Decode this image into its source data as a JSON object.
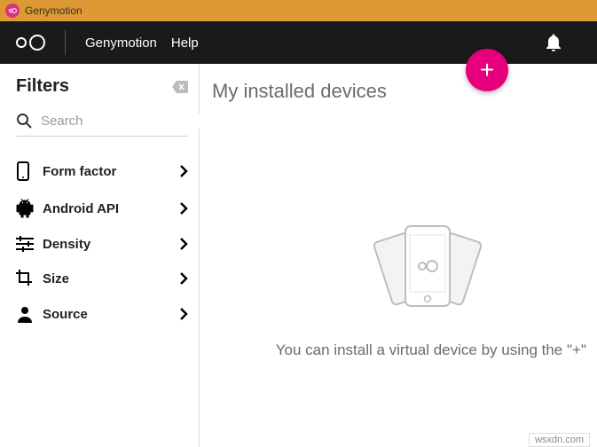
{
  "window": {
    "title": "Genymotion"
  },
  "menubar": {
    "items": [
      "Genymotion",
      "Help"
    ]
  },
  "sidebar": {
    "title": "Filters",
    "search_placeholder": "Search",
    "filters": [
      {
        "label": "Form factor",
        "icon": "phone-icon"
      },
      {
        "label": "Android API",
        "icon": "android-icon"
      },
      {
        "label": "Density",
        "icon": "sliders-icon"
      },
      {
        "label": "Size",
        "icon": "crop-icon"
      },
      {
        "label": "Source",
        "icon": "person-icon"
      }
    ]
  },
  "main": {
    "heading": "My installed devices",
    "empty_hint": "You can install a virtual device by using the \"+\""
  },
  "fab": {
    "label": "+"
  },
  "footer": {
    "watermark": "wsxdn.com"
  }
}
